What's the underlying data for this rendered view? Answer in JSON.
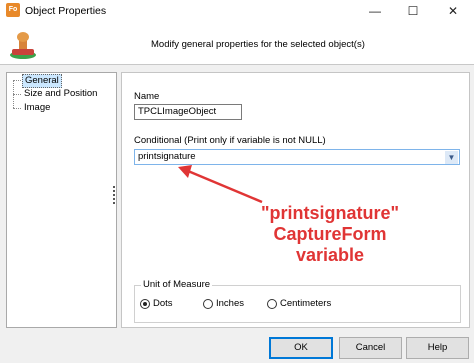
{
  "window": {
    "title": "Object Properties",
    "app_icon_text": "Fo"
  },
  "header": {
    "description": "Modify general properties for the selected object(s)"
  },
  "tree": {
    "items": [
      "General",
      "Size and Position",
      "Image"
    ],
    "selected": "General"
  },
  "form": {
    "name_label": "Name",
    "name_value": "TPCLImageObject",
    "conditional_label": "Conditional (Print only if variable is not NULL)",
    "conditional_value": "printsignature"
  },
  "unit_of_measure": {
    "title": "Unit of Measure",
    "options": [
      "Dots",
      "Inches",
      "Centimeters"
    ],
    "selected": "Dots"
  },
  "annotation": {
    "lines": [
      "\"printsignature\"",
      "CaptureForm",
      "variable"
    ],
    "color": "#e03535"
  },
  "buttons": {
    "ok": "OK",
    "cancel": "Cancel",
    "help": "Help"
  },
  "colors": {
    "selection": "#cce8ff",
    "focus_border": "#0078d7"
  }
}
